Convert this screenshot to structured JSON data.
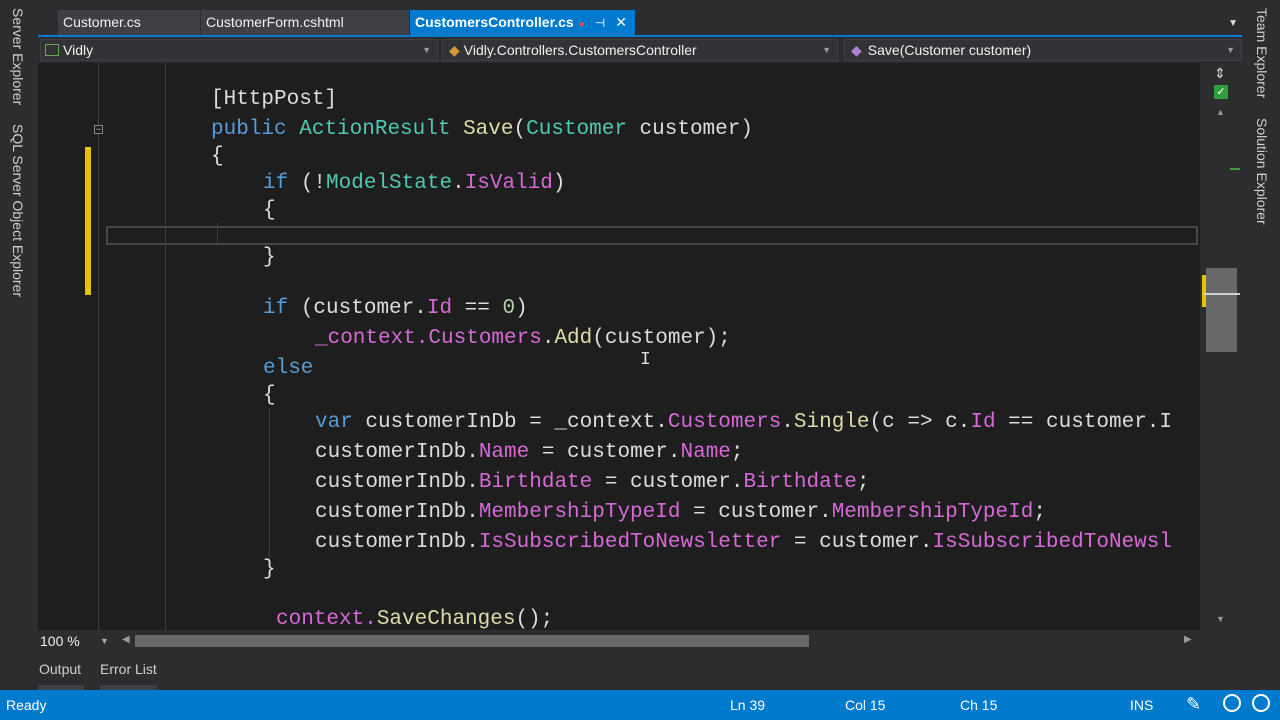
{
  "side_left": [
    "Server Explorer",
    "SQL Server Object Explorer"
  ],
  "side_right": [
    "Team Explorer",
    "Solution Explorer"
  ],
  "tabs": [
    {
      "label": "Customer.cs",
      "active": false
    },
    {
      "label": "CustomerForm.cshtml",
      "active": false
    },
    {
      "label": "CustomersController.cs",
      "active": true
    }
  ],
  "tab_icons": {
    "modified": "●",
    "pin": "⊣",
    "close": "✕"
  },
  "navigation": {
    "project": "Vidly",
    "class": "Vidly.Controllers.CustomersController",
    "member": "Save(Customer customer)"
  },
  "code": {
    "attribute": "[HttpPost]",
    "signature": {
      "mod": "public",
      "type": "ActionResult",
      "name": "Save",
      "ptype": "Customer",
      "pname": "customer"
    },
    "brace_open": "{",
    "brace_close": "}",
    "if1": "if",
    "bang": "(!",
    "modelstate": "ModelState",
    "dot": ".",
    "isvalid": "IsValid",
    "rparen": ")",
    "if2_open": "(customer.",
    "id": "Id",
    "eq": " == ",
    "zero": "0",
    "ctx": "_context.",
    "customers": "Customers",
    "add": "Add",
    "add_arg": "(customer);",
    "else": "else",
    "var": "var",
    "var_rest": " customerInDb = _context.",
    "single": "Single",
    "lambda": "(c => c.",
    "lambda_rest": " == customer.I",
    "cid": "customerInDb.",
    "assign": " = customer.",
    "name": "Name",
    "birthdate": "Birthdate",
    "membership": "MembershipTypeId",
    "subscribed": "IsSubscribedToNewsletter",
    "subscribed_trunc": "IsSubscribedToNewsl",
    "semi": ";",
    "save_ctx": "context.",
    "save_changes": "SaveChanges",
    "save_end": "();"
  },
  "zoom": "100 %",
  "output_tabs": [
    "Output",
    "Error List"
  ],
  "status": {
    "state": "Ready",
    "line": "Ln 39",
    "col": "Col 15",
    "ch": "Ch 15",
    "mode": "INS"
  },
  "colors": {
    "accent": "#007acc",
    "editor_bg": "#1e1e1e",
    "change_marker": "#e5c300"
  }
}
